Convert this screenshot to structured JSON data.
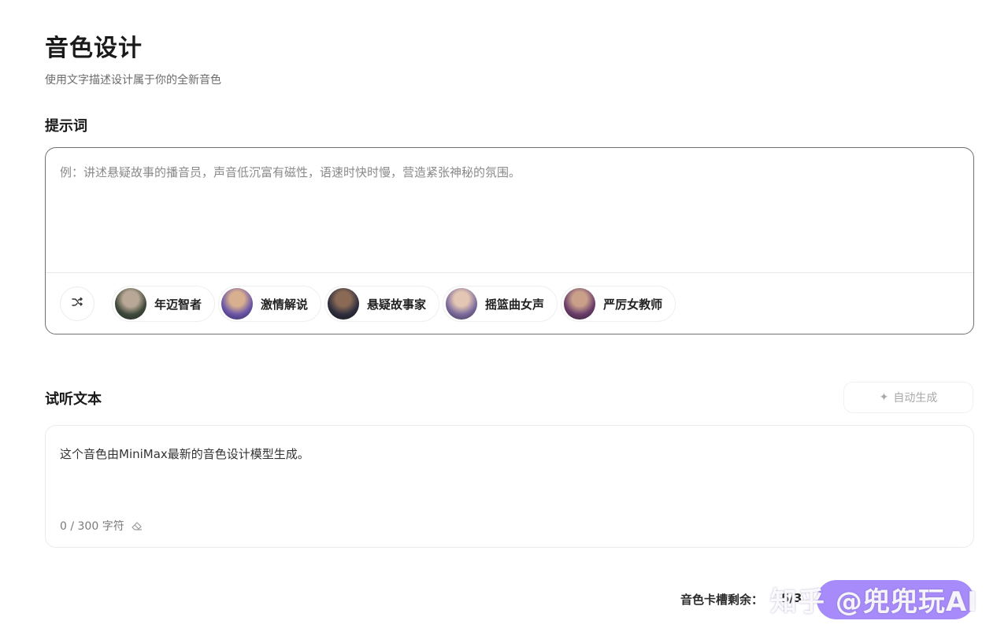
{
  "header": {
    "title": "音色设计",
    "subtitle": "使用文字描述设计属于你的全新音色"
  },
  "prompt": {
    "label": "提示词",
    "placeholder": "例：讲述悬疑故事的播音员，声音低沉富有磁性，语速时快时慢，营造紧张神秘的氛围。",
    "shuffle_icon": "shuffle-icon",
    "presets": [
      {
        "label": "年迈智者",
        "avatar_color": "#4a5a4a"
      },
      {
        "label": "激情解说",
        "avatar_color": "#5a4a8a"
      },
      {
        "label": "悬疑故事家",
        "avatar_color": "#2a2a3a"
      },
      {
        "label": "摇篮曲女声",
        "avatar_color": "#6a5a8a"
      },
      {
        "label": "严厉女教师",
        "avatar_color": "#5a3a5a"
      }
    ]
  },
  "preview": {
    "label": "试听文本",
    "auto_generate": "自动生成",
    "text": "这个音色由MiniMax最新的音色设计模型生成。",
    "char_count": "0 / 300 字符"
  },
  "footer": {
    "slots_label": "音色卡槽剩余：",
    "slots_value": "5/3",
    "watermark": "知乎 @兜兜玩AI"
  },
  "colors": {
    "accent": "#a78bfa",
    "border_dark": "#6f6f6f",
    "muted_text": "#8a8a8a"
  }
}
